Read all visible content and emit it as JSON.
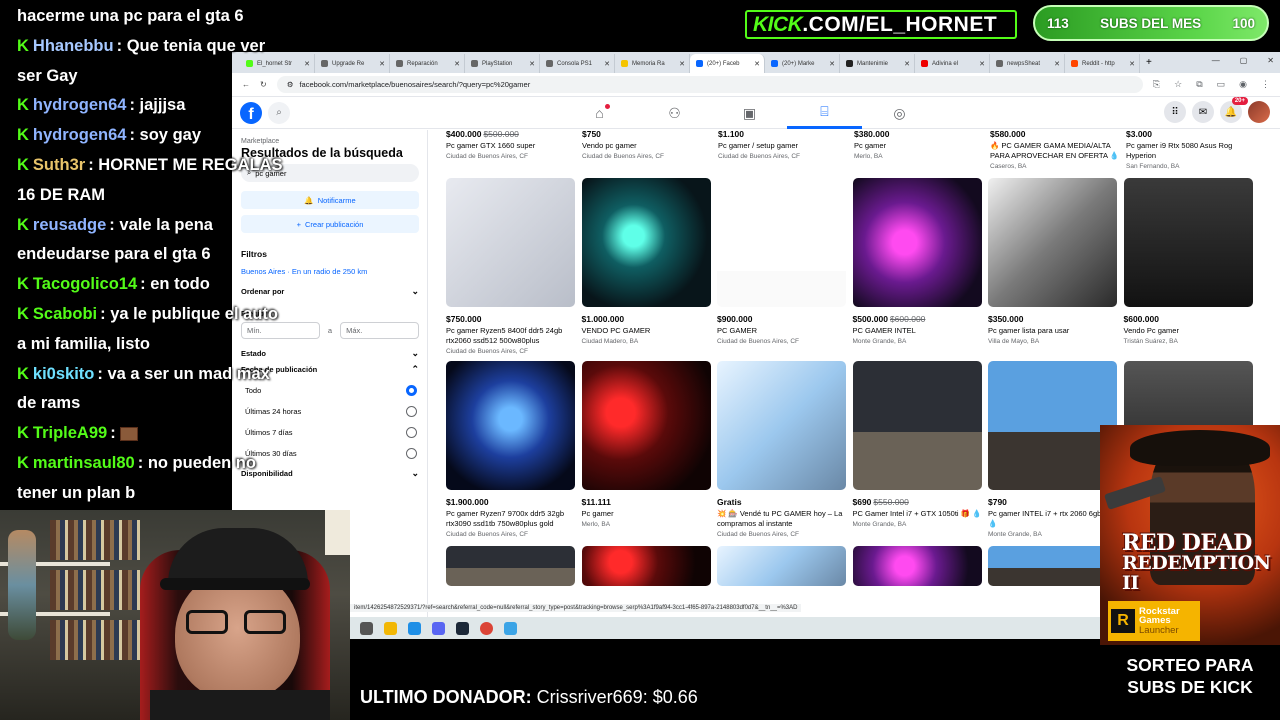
{
  "chat": [
    {
      "user": "",
      "text": "hacerme una pc para el gta 6",
      "color": "#ffffff",
      "k": false
    },
    {
      "user": "Hhanebbu",
      "text": "Que tenia que ver",
      "color": "#a6c8ff",
      "k": true
    },
    {
      "user": "",
      "text": "ser Gay",
      "color": "#ffffff",
      "k": false
    },
    {
      "user": "hydrogen64",
      "text": "jajjjsa",
      "color": "#8fb4ff",
      "k": true
    },
    {
      "user": "hydrogen64",
      "text": "soy gay",
      "color": "#8fb4ff",
      "k": true
    },
    {
      "user": "Suth3r",
      "text": "HORNET ME REGALAS",
      "color": "#e8c46a",
      "k": true
    },
    {
      "user": "",
      "text": "16 DE RAM",
      "color": "#ffffff",
      "k": false
    },
    {
      "user": "reusadge",
      "text": "vale la pena",
      "color": "#8fb4ff",
      "k": true
    },
    {
      "user": "",
      "text": "endeudarse para el gta 6",
      "color": "#ffffff",
      "k": false
    },
    {
      "user": "Tacogolico14",
      "text": "en todo",
      "color": "#53fc18",
      "k": true
    },
    {
      "user": "Scabobi",
      "text": "ya le publique el auto",
      "color": "#53fc18",
      "k": true
    },
    {
      "user": "",
      "text": "a mi familia, listo",
      "color": "#ffffff",
      "k": false
    },
    {
      "user": "ki0skito",
      "text": "va a ser un mad max",
      "color": "#6ee0ff",
      "k": true
    },
    {
      "user": "",
      "text": "de rams",
      "color": "#ffffff",
      "k": false
    },
    {
      "user": "TripleA99",
      "text": "",
      "color": "#53fc18",
      "k": true,
      "emote": true
    },
    {
      "user": "martinsaul80",
      "text": "no pueden no",
      "color": "#53fc18",
      "k": true
    },
    {
      "user": "",
      "text": "tener un plan b",
      "color": "#ffffff",
      "k": false
    }
  ],
  "overlay": {
    "kick_prefix": "KICK",
    "kick_rest": ".COM/EL_HORNET",
    "subs_current": "113",
    "subs_label": "SUBS DEL MES",
    "subs_goal": "100",
    "donor_label": "ULTIMO DONADOR:",
    "donor_value": "Crissriver669: $0.66",
    "promo_line1": "RED DEAD",
    "promo_line2": "REDEMPTION II",
    "rockstar_1": "Rockstar",
    "rockstar_2": "Games",
    "rockstar_3": "Launcher",
    "promo_text_1": "SORTEO PARA",
    "promo_text_2": "SUBS DE KICK"
  },
  "browser": {
    "tabs": [
      {
        "label": "El_hornet Str",
        "color": "#53fc18"
      },
      {
        "label": "Upgrade Re",
        "color": "#666"
      },
      {
        "label": "Reparación",
        "color": "#666"
      },
      {
        "label": "PlayStation",
        "color": "#666"
      },
      {
        "label": "Consola PS1",
        "color": "#666"
      },
      {
        "label": "Memoria Ra",
        "color": "#f5c400"
      },
      {
        "label": "(20+) Faceb",
        "color": "#0866ff",
        "active": true
      },
      {
        "label": "(20+) Marke",
        "color": "#0866ff"
      },
      {
        "label": "Mantenimie",
        "color": "#222"
      },
      {
        "label": "Adivina el",
        "color": "#e00"
      },
      {
        "label": "newpsSheat",
        "color": "#666"
      },
      {
        "label": "Reddit - http",
        "color": "#ff4500"
      }
    ],
    "url": "facebook.com/marketplace/buenosaires/search/?query=pc%20gamer",
    "status_url": "item/1426254872529371/?ref=search&referral_code=null&referral_story_type=post&tracking=browse_serp%3A1f9af94-3cc1-4f65-897a-2148803df0d7&__tn__=%3AD"
  },
  "facebook": {
    "marketplace": "Marketplace",
    "results_title": "Resultados de la búsqueda",
    "search_value": "pc gamer",
    "notify_label": "Notificarme",
    "create_label": "Crear publicación",
    "filters_label": "Filtros",
    "location": "Buenos Aires · En un radio de 250 km",
    "sort_label": "Ordenar por",
    "price_label": "Precio",
    "min_placeholder": "Mín.",
    "to_label": "a",
    "max_placeholder": "Máx.",
    "state_label": "Estado",
    "date_label": "Fecha de publicación",
    "date_options": [
      {
        "label": "Todo",
        "selected": true
      },
      {
        "label": "Últimas 24 horas",
        "selected": false
      },
      {
        "label": "Últimos 7 días",
        "selected": false
      },
      {
        "label": "Últimos 30 días",
        "selected": false
      }
    ],
    "avail_label": "Disponibilidad",
    "notif_count": "20+"
  },
  "listings_top": [
    {
      "price": "$400.000",
      "old": "$500.000",
      "title": "Pc gamer GTX 1660 super",
      "loc": "Ciudad de Buenos Aires, CF"
    },
    {
      "price": "$750",
      "old": "",
      "title": "Vendo pc gamer",
      "loc": "Ciudad de Buenos Aires, CF"
    },
    {
      "price": "$1.100",
      "old": "",
      "title": "Pc gamer / setup gamer",
      "loc": "Ciudad de Buenos Aires, CF"
    },
    {
      "price": "$380.000",
      "old": "",
      "title": "Pc gamer",
      "loc": "Merlo, BA"
    },
    {
      "price": "$580.000",
      "old": "",
      "title": "🔥 PC GAMER GAMA MEDIA/ALTA PARA APROVECHAR EN OFERTA 💧",
      "loc": "Caseros, BA"
    },
    {
      "price": "$3.000",
      "old": "",
      "title": "Pc gamer i9 Rtx 5080 Asus Rog Hyperion",
      "loc": "San Fernando, BA"
    }
  ],
  "listings_row1": [
    {
      "price": "$750.000",
      "old": "",
      "title": "Pc gamer Ryzen5 8400f ddr5 24gb rtx2060 ssd512 500w80plus",
      "loc": "Ciudad de Buenos Aires, CF",
      "img": "screen"
    },
    {
      "price": "$1.000.000",
      "old": "",
      "title": "VENDO PC GAMER",
      "loc": "Ciudad Madero, BA",
      "img": "cyan"
    },
    {
      "price": "$900.000",
      "old": "",
      "title": "PC GAMER",
      "loc": "Ciudad de Buenos Aires, CF",
      "img": "ad"
    },
    {
      "price": "$500.000",
      "old": "$600.000",
      "title": "PC GAMER INTEL",
      "loc": "Monte Grande, BA",
      "img": "pink"
    },
    {
      "price": "$350.000",
      "old": "",
      "title": "Pc gamer lista para usar",
      "loc": "Villa de Mayo, BA",
      "img": "psu"
    },
    {
      "price": "$600.000",
      "old": "",
      "title": "Vendo Pc gamer",
      "loc": "Tristán Suárez, BA",
      "img": "black"
    }
  ],
  "listings_row2": [
    {
      "price": "$1.900.000",
      "old": "",
      "title": "Pc gamer Ryzen7 9700x ddr5 32gb rtx3090 ssd1tb 750w80plus gold",
      "loc": "Ciudad de Buenos Aires, CF",
      "img": "blue"
    },
    {
      "price": "$11.111",
      "old": "",
      "title": "Pc gamer",
      "loc": "Merlo, BA",
      "img": "red"
    },
    {
      "price": "Gratis",
      "old": "",
      "title": "💥 🎰 Vendé tu PC GAMER hoy – La compramos al instante",
      "loc": "Ciudad de Buenos Aires, CF",
      "img": "white"
    },
    {
      "price": "$690",
      "old": "$550.000",
      "title": "PC Gamer Intel i7 + GTX 1050ti 🎁 💧",
      "loc": "Monte Grande, BA",
      "img": "desk"
    },
    {
      "price": "$790",
      "old": "",
      "title": "Pc gamer INTEL i7 + rtx 2060 6gb 🎁 💧",
      "loc": "Monte Grande, BA",
      "img": "desk2"
    },
    {
      "price": "",
      "old": "",
      "title": "",
      "loc": "",
      "img": "dark"
    }
  ],
  "colors": {
    "kick_green": "#53fc18",
    "facebook_blue": "#0866ff",
    "promo_orange": "#e85a1b"
  }
}
